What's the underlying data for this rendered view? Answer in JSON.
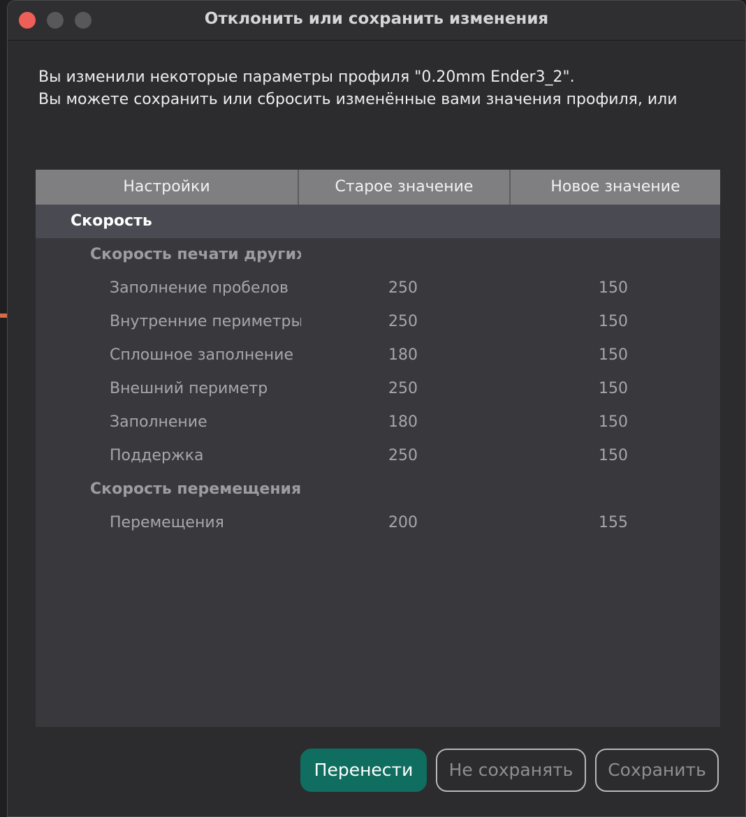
{
  "window": {
    "title": "Отклонить или сохранить изменения"
  },
  "message": {
    "line1": "Вы изменили некоторые параметры профиля \"0.20mm Ender3_2\".",
    "line2": "Вы можете сохранить или сбросить изменённые вами значения профиля, или"
  },
  "table": {
    "headers": [
      "Настройки",
      "Старое значение",
      "Новое значение"
    ],
    "rows": [
      {
        "level": 0,
        "name": "Скорость",
        "old": "",
        "new": ""
      },
      {
        "level": 1,
        "name": "Скорость печати других",
        "old": "",
        "new": ""
      },
      {
        "level": 2,
        "name": "Заполнение пробелов",
        "old": "250",
        "new": "150"
      },
      {
        "level": 2,
        "name": "Внутренние периметры",
        "old": "250",
        "new": "150"
      },
      {
        "level": 2,
        "name": "Сплошное заполнение",
        "old": "180",
        "new": "150"
      },
      {
        "level": 2,
        "name": "Внешний периметр",
        "old": "250",
        "new": "150"
      },
      {
        "level": 2,
        "name": "Заполнение",
        "old": "180",
        "new": "150"
      },
      {
        "level": 2,
        "name": "Поддержка",
        "old": "250",
        "new": "150"
      },
      {
        "level": 1,
        "name": "Скорость перемещения",
        "old": "",
        "new": ""
      },
      {
        "level": 2,
        "name": "Перемещения",
        "old": "200",
        "new": "155"
      }
    ]
  },
  "buttons": {
    "transfer": "Перенести",
    "discard": "Не сохранять",
    "save": "Сохранить"
  },
  "colors": {
    "accent": "#0f6e5f",
    "close": "#ee5f58",
    "header_bg": "#7f7f82",
    "group_bg": "#4a4a52"
  }
}
